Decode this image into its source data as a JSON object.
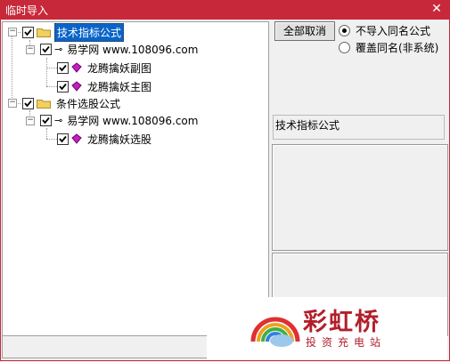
{
  "window": {
    "title": "临时导入",
    "close_glyph": "✕"
  },
  "tree": {
    "nodes": [
      {
        "label": "技术指标公式"
      },
      {
        "label": "易学网 www.108096.com"
      },
      {
        "label": "龙腾擒妖副图"
      },
      {
        "label": "龙腾擒妖主图"
      },
      {
        "label": "条件选股公式"
      },
      {
        "label": "易学网 www.108096.com"
      },
      {
        "label": "龙腾擒妖选股"
      }
    ],
    "expander_glyph": "−",
    "key_glyph": "⊸"
  },
  "actions": {
    "select_all_label": "全部取消",
    "radio_no_import": "不导入同名公式",
    "radio_overwrite": "覆盖同名(非系统)",
    "selected_radio": "no_import"
  },
  "info": {
    "label": "技术指标公式"
  },
  "watermark": {
    "title": "彩虹桥",
    "subtitle": "投资充电站"
  },
  "colors": {
    "title_bar": "#c8293a",
    "selection": "#0a64c8",
    "gem": "#c020c0",
    "folder": "#f0d060"
  }
}
